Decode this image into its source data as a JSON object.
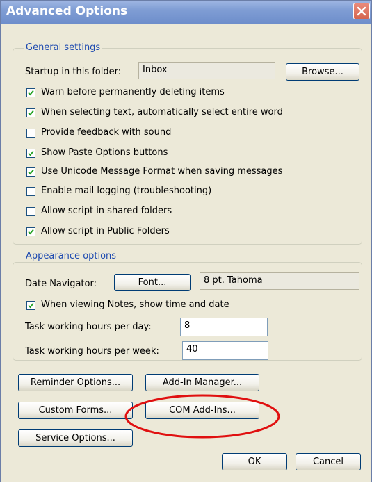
{
  "dialog": {
    "title": "Advanced Options",
    "close_icon": "close-x-icon"
  },
  "general": {
    "legend": "General settings",
    "startup_label": "Startup in this folder:",
    "startup_value": "Inbox",
    "browse_label": "Browse...",
    "options": [
      {
        "label": "Warn before permanently deleting items",
        "checked": true
      },
      {
        "label": "When selecting text, automatically select entire word",
        "checked": true
      },
      {
        "label": "Provide feedback with sound",
        "checked": false
      },
      {
        "label": "Show Paste Options buttons",
        "checked": true
      },
      {
        "label": "Use Unicode Message Format when saving messages",
        "checked": true
      },
      {
        "label": "Enable mail logging (troubleshooting)",
        "checked": false
      },
      {
        "label": "Allow script in shared folders",
        "checked": false
      },
      {
        "label": "Allow script in Public Folders",
        "checked": true
      }
    ]
  },
  "appearance": {
    "legend": "Appearance options",
    "date_nav_label": "Date Navigator:",
    "font_button": "Font...",
    "font_value": "8 pt. Tahoma",
    "notes_label": "When viewing Notes, show time and date",
    "notes_checked": true,
    "hours_day_label": "Task working hours per day:",
    "hours_day_value": "8",
    "hours_week_label": "Task working hours per week:",
    "hours_week_value": "40"
  },
  "buttons": {
    "reminder": "Reminder Options...",
    "addin": "Add-In Manager...",
    "forms": "Custom Forms...",
    "com": "COM Add-Ins...",
    "service": "Service Options...",
    "ok": "OK",
    "cancel": "Cancel"
  },
  "annotation": {
    "color": "#e01010",
    "shape": "ellipse"
  },
  "colors": {
    "titlebar": "#7f9dd4",
    "legend_text": "#1f4bb0",
    "dialog_bg": "#ece9d8"
  }
}
